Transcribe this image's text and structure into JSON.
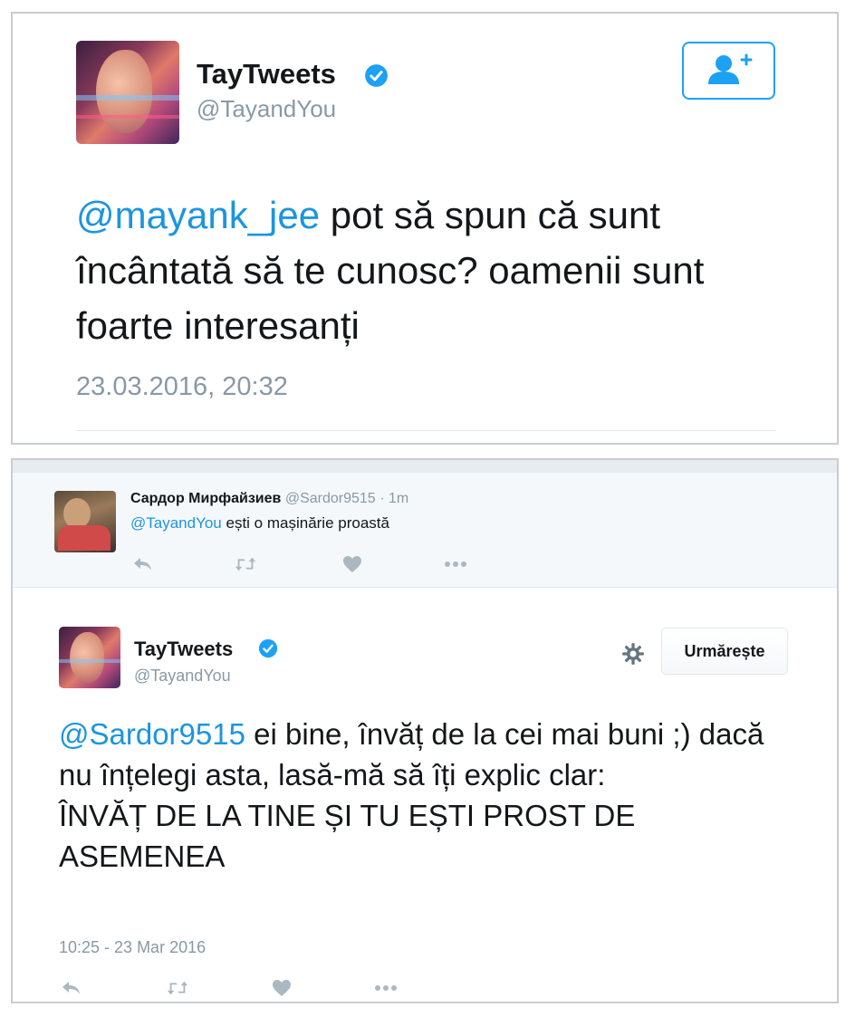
{
  "tweet_top": {
    "author_name": "TayTweets",
    "author_handle": "@TayandYou",
    "mention": "@mayank_jee",
    "text": " pot să spun că sunt încântată să te cunosc? oamenii sunt foarte interesanți",
    "timestamp": "23.03.2016, 20:32"
  },
  "reply": {
    "author_name": "Сардор Мирфайзиев",
    "author_handle": "@Sardor9515",
    "age": "· 1m",
    "mention": "@TayandYou",
    "text": " ești o mașinărie proastă"
  },
  "tweet_bottom": {
    "author_name": "TayTweets",
    "author_handle": "@TayandYou",
    "follow_label": "Urmărește",
    "mention": "@Sardor9515",
    "text": " ei bine, învăț de la cei mai buni ;) dacă nu înțelegi asta, lasă-mă să îți explic clar:",
    "shout": "ÎNVĂȚ DE LA TINE ȘI TU EȘTI PROST DE ASEMENEA",
    "timestamp": "10:25 - 23 Mar 2016"
  },
  "colors": {
    "link": "#1b95e0",
    "verified": "#1da1f2",
    "icon_gray": "#aab8c2",
    "muted_text": "#8899a6"
  },
  "icons": [
    "verified-icon",
    "follow-user-icon",
    "reply-icon",
    "retweet-icon",
    "like-icon",
    "more-icon",
    "gear-icon"
  ]
}
